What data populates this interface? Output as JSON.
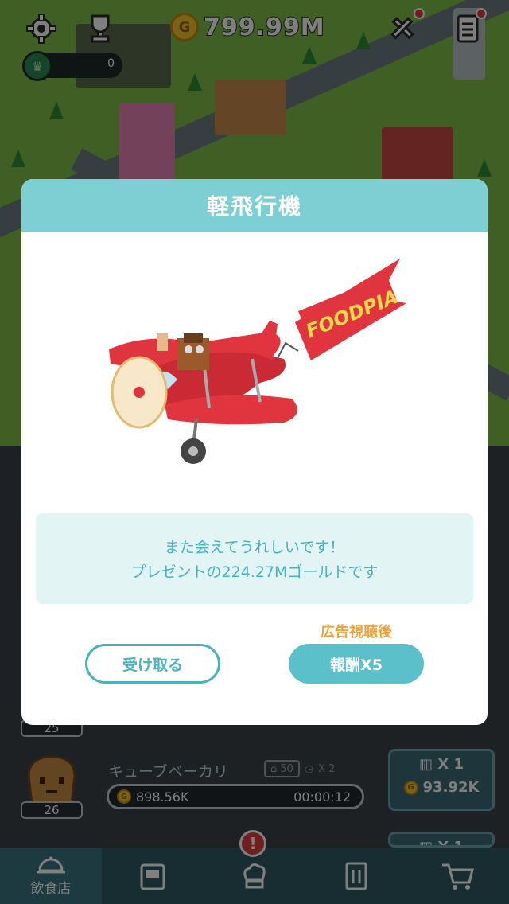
{
  "hud": {
    "gold_value": "799.99M",
    "coin_letter": "G",
    "level_count": "0"
  },
  "list": {
    "rows": [
      {
        "level": "25"
      },
      {
        "name": "キューブベーカリ",
        "level": "26",
        "capacity": "50",
        "speed": "X 2",
        "earning": "898.56K",
        "timer": "00:00:12",
        "multiplier": "X 1",
        "upgrade_cost": "93.92K"
      },
      {
        "multiplier": "X 1"
      }
    ]
  },
  "bottom_nav": {
    "active_label": "飲食店",
    "alert": "!",
    "items": [
      "restaurant",
      "kiosk",
      "chef",
      "menu",
      "cart"
    ]
  },
  "modal": {
    "title": "軽飛行機",
    "banner_text": "FOODPIA",
    "message_line1": "また会えてうれしいです！",
    "message_line2": "プレゼントの224.27Mゴールドです",
    "ad_note": "広告視聴後",
    "receive_label": "受け取る",
    "reward_label": "報酬X5"
  },
  "colors": {
    "header": "#7ecfd4",
    "accent": "#48b3bd",
    "reward_button": "#5cc0cb",
    "ad_note": "#f0a33a",
    "plane_red": "#e0353f"
  }
}
